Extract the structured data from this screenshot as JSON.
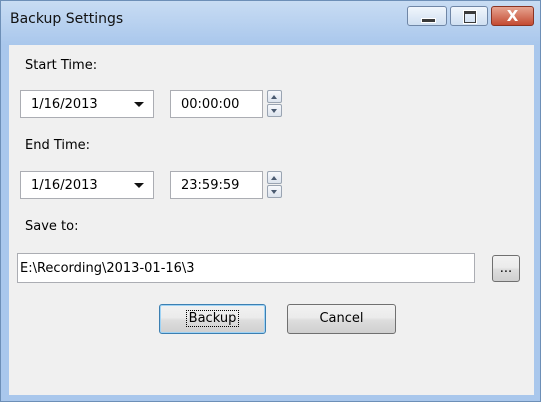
{
  "window": {
    "title": "Backup Settings",
    "close_glyph": "X"
  },
  "start": {
    "label": "Start Time:",
    "date": "1/16/2013",
    "time": "00:00:00"
  },
  "end": {
    "label": "End Time:",
    "date": "1/16/2013",
    "time": "23:59:59"
  },
  "save": {
    "label": "Save to:",
    "path": "E:\\Recording\\2013-01-16\\3",
    "browse_label": "..."
  },
  "buttons": {
    "backup": "Backup",
    "cancel": "Cancel"
  }
}
